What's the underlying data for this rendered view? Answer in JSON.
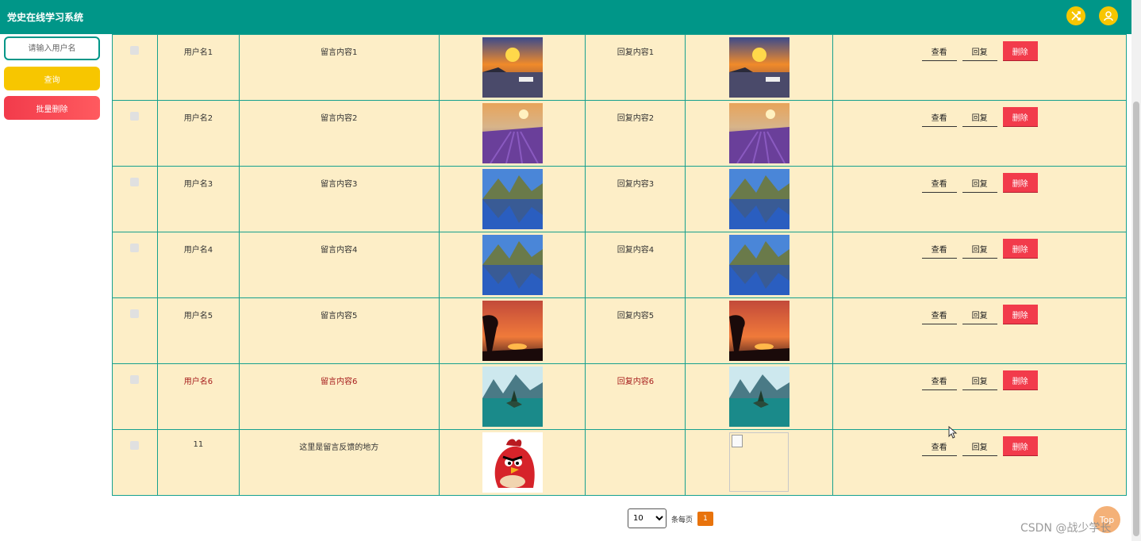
{
  "app": {
    "title": "党史在线学习系统"
  },
  "header": {
    "icons": [
      "shuffle-icon",
      "user-icon"
    ],
    "accent": "#009688",
    "icon_color": "#f7c600"
  },
  "sidebar": {
    "search_placeholder": "请输入用户名",
    "query_label": "查询",
    "batch_delete_label": "批量删除"
  },
  "table": {
    "rows": [
      {
        "username": "用户名1",
        "message": "留言内容1",
        "reply": "回复内容1",
        "image": "sunset-river-boat",
        "reply_image": "sunset-river-boat"
      },
      {
        "username": "用户名2",
        "message": "留言内容2",
        "reply": "回复内容2",
        "image": "lavender-field",
        "reply_image": "lavender-field"
      },
      {
        "username": "用户名3",
        "message": "留言内容3",
        "reply": "回复内容3",
        "image": "mountain-lake",
        "reply_image": "mountain-lake"
      },
      {
        "username": "用户名4",
        "message": "留言内容4",
        "reply": "回复内容4",
        "image": "mountain-lake",
        "reply_image": "mountain-lake"
      },
      {
        "username": "用户名5",
        "message": "留言内容5",
        "reply": "回复内容5",
        "image": "red-sunset-tree",
        "reply_image": "red-sunset-tree"
      },
      {
        "username": "用户名6",
        "message": "留言内容6",
        "reply": "回复内容6",
        "image": "teal-lake-island",
        "reply_image": "teal-lake-island"
      },
      {
        "username": "11",
        "message": "这里是留言反馈的地方",
        "reply": "",
        "image": "red-bird-cartoon",
        "reply_image": "broken-image"
      }
    ],
    "actions": {
      "view": "查看",
      "reply": "回复",
      "delete": "删除"
    }
  },
  "pagination": {
    "page_size": "10",
    "page_size_options": [
      "10"
    ],
    "per_page_label": "条每页",
    "current_page": "1"
  },
  "misc": {
    "top_button": "Top",
    "watermark": "CSDN @战少学长"
  }
}
